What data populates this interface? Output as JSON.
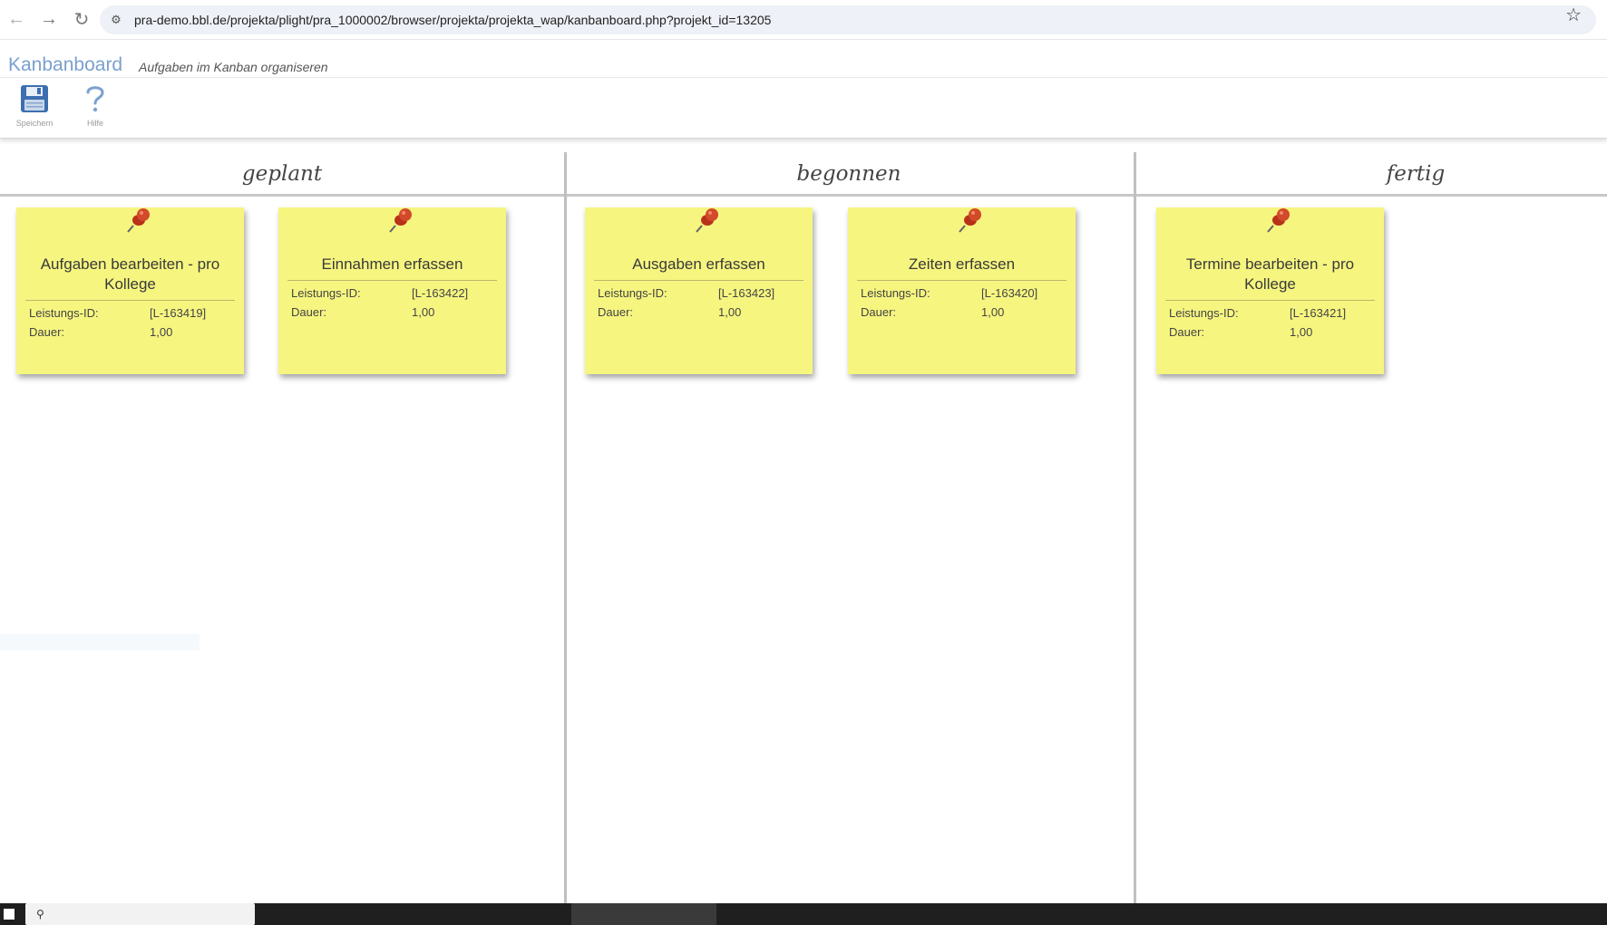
{
  "browser": {
    "url": "pra-demo.bbl.de/projekta/plight/pra_1000002/browser/projekta/projekta_wap/kanbanboard.php?projekt_id=13205"
  },
  "header": {
    "title": "Kanbanboard",
    "subtitle": "Aufgaben im Kanban organiseren",
    "tools": [
      {
        "label": "Speichern",
        "icon": "save-icon"
      },
      {
        "label": "Hilfe",
        "icon": "help-icon"
      }
    ]
  },
  "columns": [
    {
      "title": "geplant"
    },
    {
      "title": "begonnen"
    },
    {
      "title": "fertig"
    }
  ],
  "field_labels": {
    "id": "Leistungs-ID:",
    "duration": "Dauer:"
  },
  "cards": [
    {
      "title": "Aufgaben bearbeiten - pro Kollege",
      "id": "[L-163419]",
      "duration": "1,00",
      "column": "geplant"
    },
    {
      "title": "Einnahmen erfassen",
      "id": "[L-163422]",
      "duration": "1,00",
      "column": "geplant"
    },
    {
      "title": "Ausgaben erfassen",
      "id": "[L-163423]",
      "duration": "1,00",
      "column": "begonnen"
    },
    {
      "title": "Zeiten erfassen",
      "id": "[L-163420]",
      "duration": "1,00",
      "column": "begonnen"
    },
    {
      "title": "Termine bearbeiten - pro Kollege",
      "id": "[L-163421]",
      "duration": "1,00",
      "column": "fertig"
    }
  ],
  "colors": {
    "card": "#f6f580",
    "title_blue": "#7aa0cf",
    "pin": "#c23a1e"
  }
}
